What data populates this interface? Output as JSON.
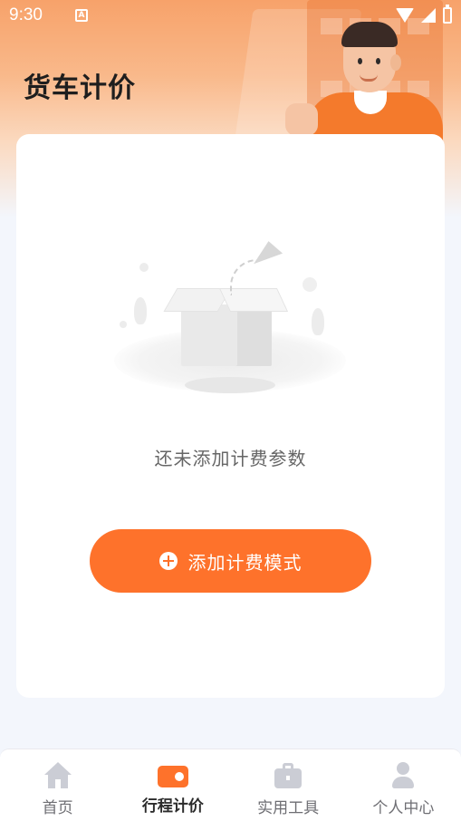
{
  "status_bar": {
    "time": "9:30",
    "notification_icon": "A"
  },
  "header": {
    "title": "货车计价"
  },
  "empty_state": {
    "message": "还未添加计费参数"
  },
  "actions": {
    "add_label": "添加计费模式"
  },
  "tabbar": {
    "items": [
      {
        "label": "首页",
        "icon": "home-icon",
        "active": false
      },
      {
        "label": "行程计价",
        "icon": "wallet-icon",
        "active": true
      },
      {
        "label": "实用工具",
        "icon": "briefcase-icon",
        "active": false
      },
      {
        "label": "个人中心",
        "icon": "person-icon",
        "active": false
      }
    ]
  },
  "colors": {
    "accent": "#fe722b",
    "background": "#f3f6fc"
  }
}
